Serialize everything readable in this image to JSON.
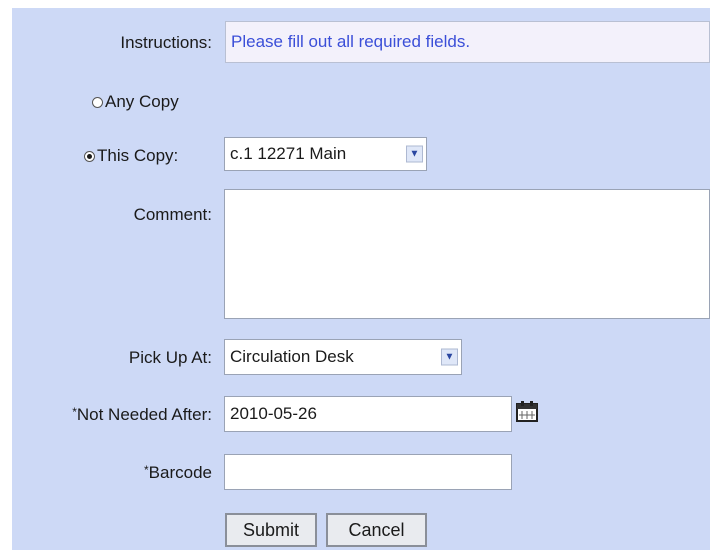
{
  "form": {
    "instructions_label": "Instructions:",
    "instructions_text": "Please fill out all required fields.",
    "any_copy_label": "Any Copy",
    "this_copy_label": "This Copy:",
    "this_copy_value": "c.1 12271 Main",
    "comment_label": "Comment:",
    "comment_value": "",
    "pickup_label": "Pick Up At:",
    "pickup_value": "Circulation Desk",
    "not_needed_label": "Not Needed After:",
    "not_needed_value": "2010-05-26",
    "barcode_label": "Barcode",
    "barcode_value": "",
    "required_marker": "*",
    "selected_copy_option": "This Copy"
  },
  "buttons": {
    "submit_label": "Submit",
    "cancel_label": "Cancel"
  },
  "icons": {
    "calendar": "calendar-icon",
    "dropdown": "chevron-down-icon"
  },
  "colors": {
    "panel_background": "#cdd9f6",
    "instructions_text": "#3b4fd8"
  }
}
